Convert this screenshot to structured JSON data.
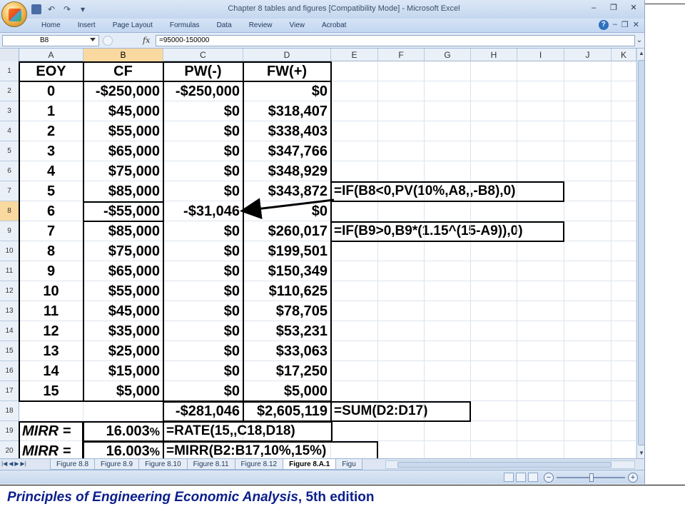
{
  "window": {
    "title": "Chapter 8 tables and figures  [Compatibility Mode] - Microsoft Excel",
    "minimize": "–",
    "restore": "❐",
    "close": "✕"
  },
  "ribbon": {
    "tabs": [
      "Home",
      "Insert",
      "Page Layout",
      "Formulas",
      "Data",
      "Review",
      "View",
      "Acrobat"
    ],
    "help": "?"
  },
  "formula_bar": {
    "name_box": "B8",
    "fx": "fx",
    "formula": "=95000-150000"
  },
  "columns": [
    "A",
    "B",
    "C",
    "D",
    "E",
    "F",
    "G",
    "H",
    "I",
    "J",
    "K"
  ],
  "selected_cell": "B8",
  "rows": [
    {
      "n": "1",
      "A": "EOY",
      "B": "CF",
      "C": "PW(-)",
      "D": "FW(+)",
      "E": ""
    },
    {
      "n": "2",
      "A": "0",
      "B": "-$250,000",
      "C": "-$250,000",
      "D": "$0",
      "E": ""
    },
    {
      "n": "3",
      "A": "1",
      "B": "$45,000",
      "C": "$0",
      "D": "$318,407",
      "E": ""
    },
    {
      "n": "4",
      "A": "2",
      "B": "$55,000",
      "C": "$0",
      "D": "$338,403",
      "E": ""
    },
    {
      "n": "5",
      "A": "3",
      "B": "$65,000",
      "C": "$0",
      "D": "$347,766",
      "E": ""
    },
    {
      "n": "6",
      "A": "4",
      "B": "$75,000",
      "C": "$0",
      "D": "$348,929",
      "E": ""
    },
    {
      "n": "7",
      "A": "5",
      "B": "$85,000",
      "C": "$0",
      "D": "$343,872",
      "E": "=IF(B8<0,PV(10%,A8,,-B8),0)"
    },
    {
      "n": "8",
      "A": "6",
      "B": "-$55,000",
      "C": "-$31,046",
      "D": "$0",
      "E": ""
    },
    {
      "n": "9",
      "A": "7",
      "B": "$85,000",
      "C": "$0",
      "D": "$260,017",
      "E": "=IF(B9>0,B9*(1.15^(15-A9)),0)"
    },
    {
      "n": "10",
      "A": "8",
      "B": "$75,000",
      "C": "$0",
      "D": "$199,501",
      "E": ""
    },
    {
      "n": "11",
      "A": "9",
      "B": "$65,000",
      "C": "$0",
      "D": "$150,349",
      "E": ""
    },
    {
      "n": "12",
      "A": "10",
      "B": "$55,000",
      "C": "$0",
      "D": "$110,625",
      "E": ""
    },
    {
      "n": "13",
      "A": "11",
      "B": "$45,000",
      "C": "$0",
      "D": "$78,705",
      "E": ""
    },
    {
      "n": "14",
      "A": "12",
      "B": "$35,000",
      "C": "$0",
      "D": "$53,231",
      "E": ""
    },
    {
      "n": "15",
      "A": "13",
      "B": "$25,000",
      "C": "$0",
      "D": "$33,063",
      "E": ""
    },
    {
      "n": "16",
      "A": "14",
      "B": "$15,000",
      "C": "$0",
      "D": "$17,250",
      "E": ""
    },
    {
      "n": "17",
      "A": "15",
      "B": "$5,000",
      "C": "$0",
      "D": "$5,000",
      "E": ""
    },
    {
      "n": "18",
      "A": "",
      "B": "",
      "C": "-$281,046",
      "D": "$2,605,119",
      "E": "=SUM(D2:D17)"
    },
    {
      "n": "19",
      "A": "MIRR =",
      "B": "16.003",
      "C": "=RATE(15,,C18,D18)",
      "D": "",
      "E": ""
    },
    {
      "n": "20",
      "A": "MIRR =",
      "B": "16.003",
      "C": "=MIRR(B2:B17,10%,15%)",
      "D": "",
      "E": ""
    }
  ],
  "percent_sign": "%",
  "sheet_tabs": [
    "Figure 8.8",
    "Figure 8.9",
    "Figure 8.10",
    "Figure 8.11",
    "Figure 8.12",
    "Figure 8.A.1",
    "Figu"
  ],
  "active_sheet": "Figure 8.A.1",
  "zoom": {
    "minus": "−",
    "plus": "+"
  },
  "footer": {
    "title": "Principles of Engineering Economic Analysis",
    "edition": ", 5th edition"
  },
  "colors": {
    "ribbon": "#c4d7ef",
    "selected_header": "#f9d99f",
    "footer_text": "#0b1e8c"
  }
}
